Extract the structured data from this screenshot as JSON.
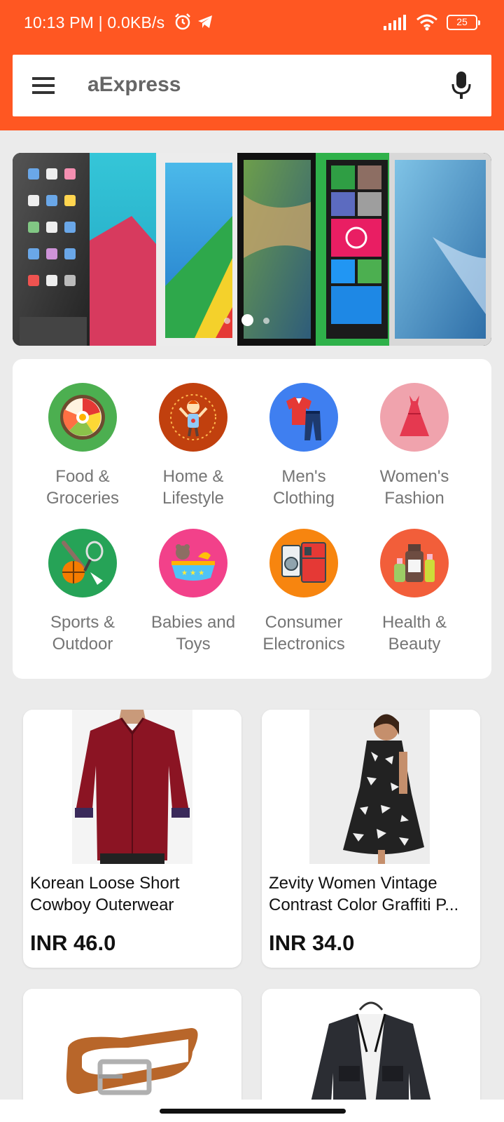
{
  "status_bar": {
    "time_speed": "10:13 PM | 0.0KB/s",
    "battery": "25",
    "icons": [
      "alarm-icon",
      "telegram-icon",
      "signal-icon",
      "wifi-icon",
      "battery-icon"
    ]
  },
  "search": {
    "placeholder": "aExpress"
  },
  "banner": {
    "active_index": 1,
    "total": 3
  },
  "categories": [
    {
      "label": "Food &\nGroceries",
      "icon": "food-bowl-icon",
      "color": "#4caf50"
    },
    {
      "label": "Home &\nLifestyle",
      "icon": "home-lifestyle-icon",
      "color": "#c1400e"
    },
    {
      "label": "Men's\nClothing",
      "icon": "mens-clothing-icon",
      "color": "#3f7ff0"
    },
    {
      "label": "Women's\nFashion",
      "icon": "dress-icon",
      "color": "#f0a3ad"
    },
    {
      "label": "Sports &\nOutdoor",
      "icon": "sports-icon",
      "color": "#26a357"
    },
    {
      "label": "Babies and\nToys",
      "icon": "toys-icon",
      "color": "#f2418a"
    },
    {
      "label": "Consumer\nElectronics",
      "icon": "electronics-icon",
      "color": "#f7850f"
    },
    {
      "label": "Health &\nBeauty",
      "icon": "health-beauty-icon",
      "color": "#f25e3a"
    }
  ],
  "products": [
    {
      "line1": "Korean Loose Short",
      "line2": "Cowboy Outerwear",
      "price": "INR 46.0",
      "image": "red-shirt-image"
    },
    {
      "line1": "Zevity Women Vintage",
      "line2": "Contrast Color Graffiti P...",
      "price": "INR 34.0",
      "image": "printed-dress-image"
    },
    {
      "line1": "",
      "line2": "",
      "price": "",
      "image": "leather-belt-image"
    },
    {
      "line1": "",
      "line2": "",
      "price": "",
      "image": "denim-jacket-image"
    }
  ]
}
